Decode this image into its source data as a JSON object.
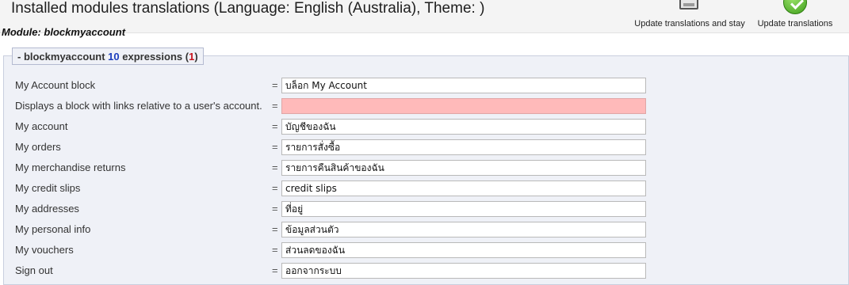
{
  "header": {
    "title": "Installed modules translations (Language: English (Australia), Theme: )",
    "update_stay_label": "Update translations and stay",
    "update_label": "Update translations"
  },
  "module_heading": "Module: blockmyaccount",
  "group": {
    "prefix": "- blockmyaccount",
    "expression_count": "10",
    "expressions_word": "expressions",
    "missing_open": "(",
    "missing_count": "1",
    "missing_close": ")"
  },
  "equals_sign": "=",
  "rows": [
    {
      "label": "My Account block",
      "value": "บล็อก My Account",
      "missing": false
    },
    {
      "label": "Displays a block with links relative to a user's account.",
      "value": "",
      "missing": true
    },
    {
      "label": "My account",
      "value": "บัญชีของฉัน",
      "missing": false
    },
    {
      "label": "My orders",
      "value": "รายการสั่งซื้อ",
      "missing": false
    },
    {
      "label": "My merchandise returns",
      "value": "รายการคืนสินค้าของฉัน",
      "missing": false
    },
    {
      "label": "My credit slips",
      "value": "credit slips",
      "missing": false
    },
    {
      "label": "My addresses",
      "value": "ที่อยู่",
      "missing": false
    },
    {
      "label": "My personal info",
      "value": "ข้อมูลส่วนตัว",
      "missing": false
    },
    {
      "label": "My vouchers",
      "value": "ส่วนลดของฉัน",
      "missing": false
    },
    {
      "label": "Sign out",
      "value": "ออกจากระบบ",
      "missing": false
    }
  ],
  "colors": {
    "missing_field": "#ffbaba",
    "count_blue": "#1b3dbd",
    "count_red": "#c8141e",
    "panel_bg": "#eff1f7"
  },
  "icons": [
    "save-icon",
    "check-icon"
  ]
}
